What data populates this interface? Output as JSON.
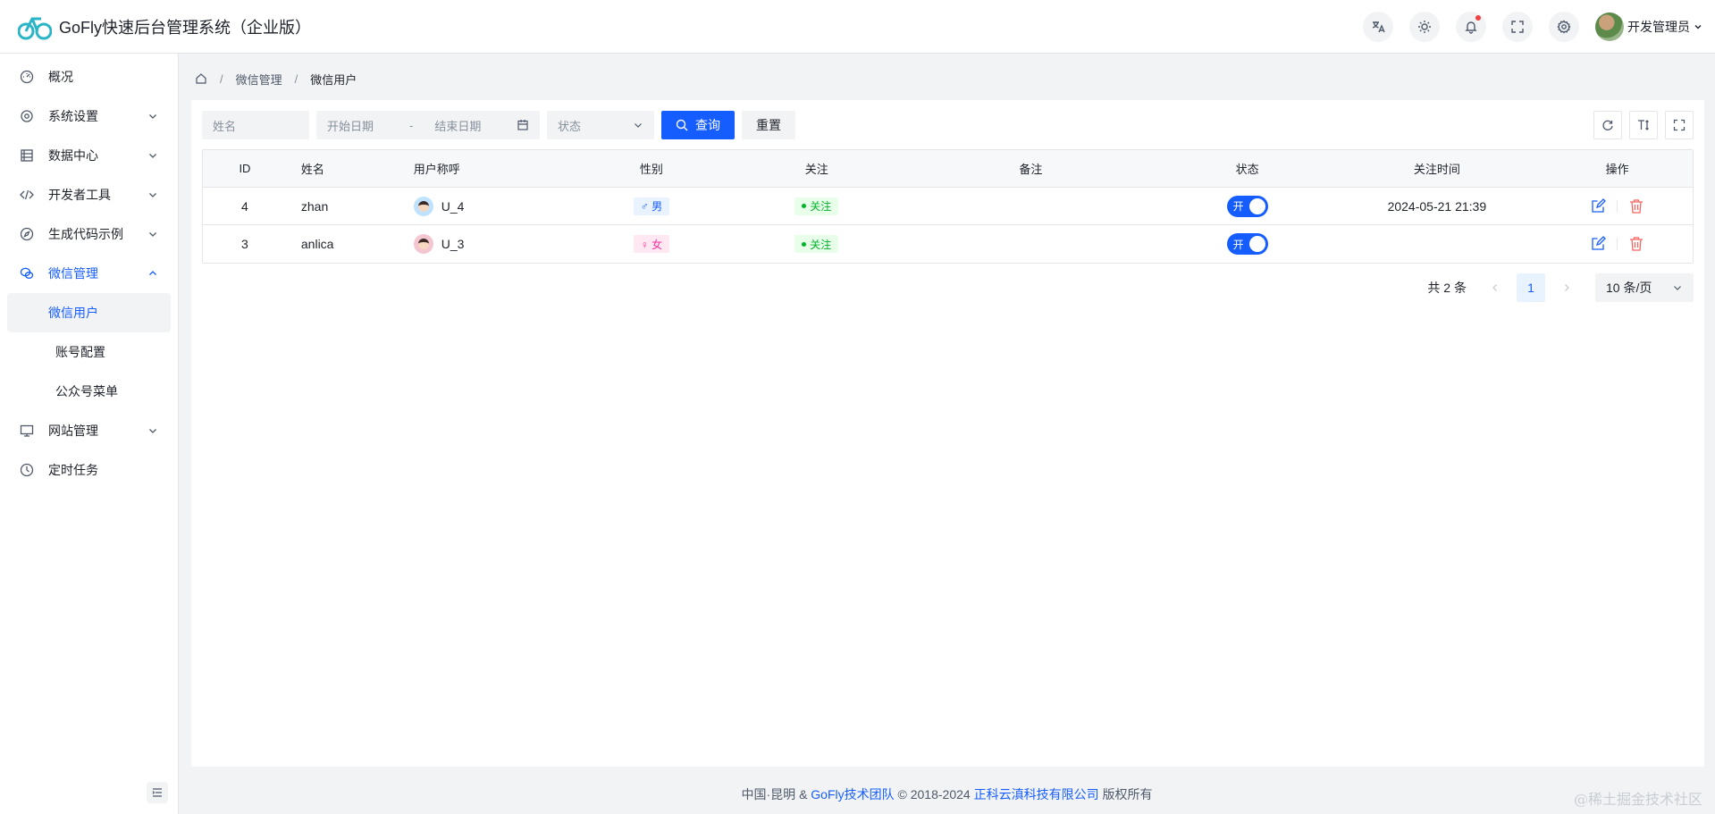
{
  "header": {
    "title": "GoFly快速后台管理系统（企业版）",
    "user_name": "开发管理员"
  },
  "sidebar": {
    "items": [
      {
        "label": "概况"
      },
      {
        "label": "系统设置"
      },
      {
        "label": "数据中心"
      },
      {
        "label": "开发者工具"
      },
      {
        "label": "生成代码示例"
      },
      {
        "label": "微信管理"
      },
      {
        "label": "网站管理"
      },
      {
        "label": "定时任务"
      }
    ],
    "wechat_sub": [
      {
        "label": "微信用户"
      },
      {
        "label": "账号配置"
      },
      {
        "label": "公众号菜单"
      }
    ]
  },
  "breadcrumb": {
    "level1": "微信管理",
    "level2": "微信用户"
  },
  "filters": {
    "name_placeholder": "姓名",
    "start_placeholder": "开始日期",
    "range_sep": "-",
    "end_placeholder": "结束日期",
    "status_placeholder": "状态",
    "search_label": "查询",
    "reset_label": "重置"
  },
  "table": {
    "columns": [
      "ID",
      "姓名",
      "用户称呼",
      "性别",
      "关注",
      "备注",
      "状态",
      "关注时间",
      "操作"
    ],
    "rows": [
      {
        "id": "4",
        "name": "zhan",
        "nickname": "U_4",
        "gender": "♂ 男",
        "follow": "关注",
        "remark": "",
        "status": "开",
        "time": "2024-05-21 21:39"
      },
      {
        "id": "3",
        "name": "anlica",
        "nickname": "U_3",
        "gender": "♀ 女",
        "follow": "关注",
        "remark": "",
        "status": "开",
        "time": ""
      }
    ]
  },
  "pagination": {
    "total": "共 2 条",
    "current": "1",
    "page_size": "10 条/页"
  },
  "footer": {
    "prefix": "中国·昆明 &",
    "team": "GoFly技术团队",
    "copyright": "© 2018-2024",
    "company": "正科云滇科技有限公司",
    "suffix": "版权所有"
  },
  "watermark": "@稀土掘金技术社区",
  "colors": {
    "primary": "#165dff",
    "success": "#00b42a",
    "danger": "#f76560",
    "female": "#f5319d"
  }
}
